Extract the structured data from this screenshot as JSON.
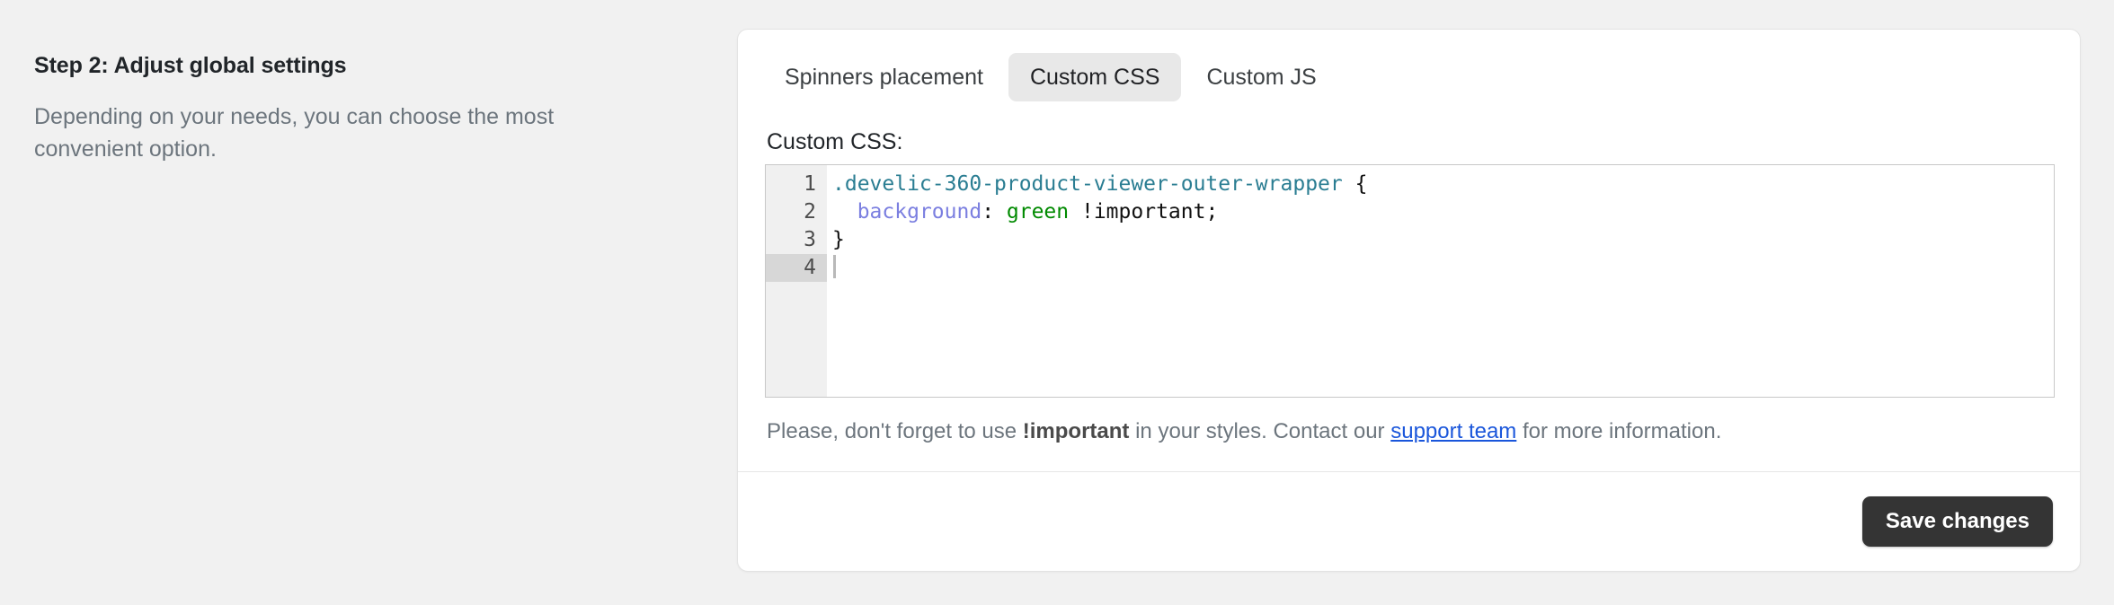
{
  "left_panel": {
    "title": "Step 2: Adjust global settings",
    "description": "Depending on your needs, you can choose the most convenient option."
  },
  "card": {
    "tabs": [
      {
        "label": "Spinners placement",
        "active": false
      },
      {
        "label": "Custom CSS",
        "active": true
      },
      {
        "label": "Custom JS",
        "active": false
      }
    ],
    "field_label": "Custom CSS:",
    "editor": {
      "line_numbers": [
        "1",
        "2",
        "3",
        "4"
      ],
      "active_line": 4,
      "lines": [
        {
          "number": "1",
          "selector": ".develic-360-product-viewer-outer-wrapper",
          "brace": " {"
        },
        {
          "number": "2",
          "indent": "  ",
          "property": "background",
          "colon": ": ",
          "value": "green",
          "suffix": " !important;"
        },
        {
          "number": "3",
          "plain": "}"
        },
        {
          "number": "4",
          "plain": ""
        }
      ],
      "syntax_colors": {
        "selector": "#2a7d92",
        "property": "#7b7fe0",
        "value": "#008a00",
        "plain": "#111111"
      }
    },
    "note": {
      "before": "Please, don't forget to use ",
      "bold": "!important",
      "middle": " in your styles. Contact our ",
      "link": "support team",
      "after": " for more information."
    },
    "footer": {
      "save_label": "Save changes"
    }
  },
  "theme": {
    "page_background": "#f1f1f1",
    "card_background": "#ffffff",
    "active_tab_background": "#e8e8e8",
    "button_background": "#343434",
    "link_color": "#1a56db",
    "gutter_background": "#f0f0f0",
    "active_gutter_background": "#d7d7d7"
  }
}
